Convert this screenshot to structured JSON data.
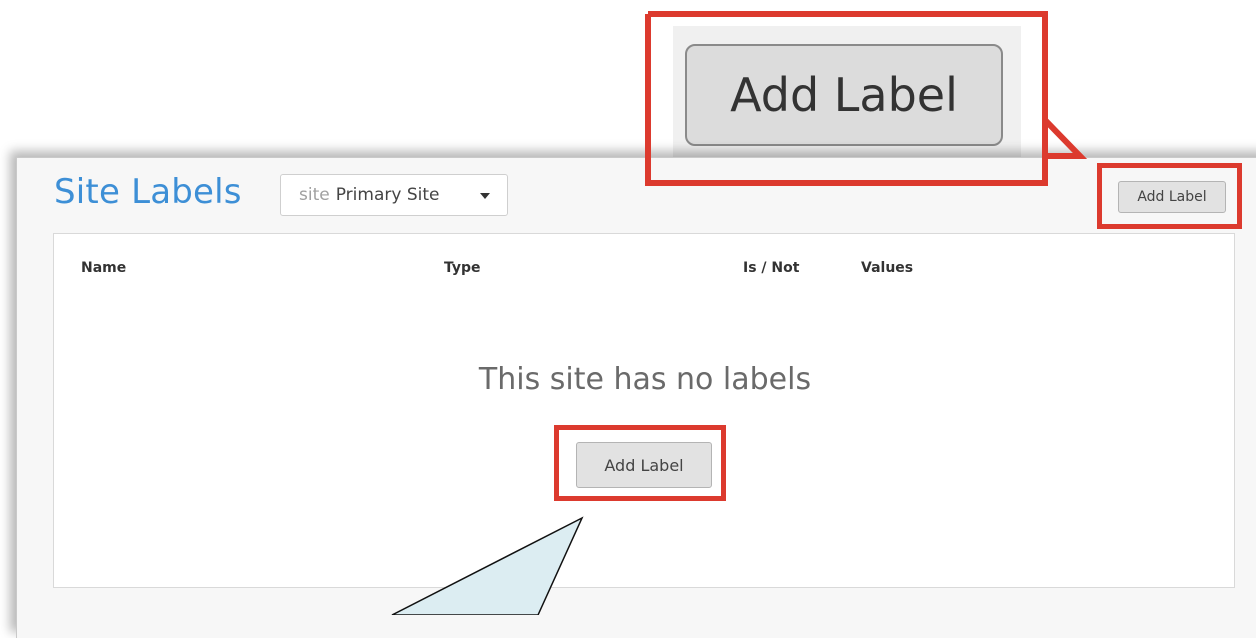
{
  "header": {
    "title": "Site Labels",
    "site_selector": {
      "prefix": "site",
      "value": "Primary Site"
    },
    "add_label_button": "Add Label"
  },
  "table": {
    "columns": [
      "Name",
      "Type",
      "Is / Not",
      "Values"
    ],
    "rows": []
  },
  "empty_state": {
    "message": "This site has no labels",
    "add_label_button": "Add Label"
  },
  "callout": {
    "zoomed_button_label": "Add Label"
  },
  "colors": {
    "title": "#3d8fd6",
    "highlight": "#dc3a2e",
    "tooltip_fill": "#dcedf2"
  }
}
